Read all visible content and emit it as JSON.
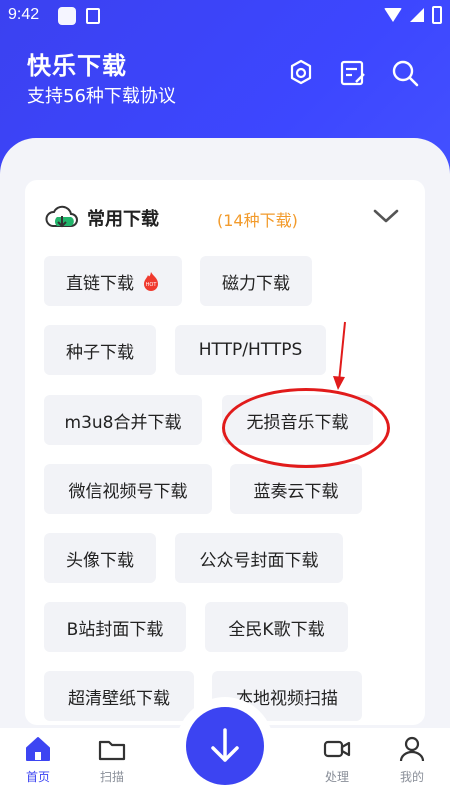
{
  "status_bar": {
    "time": "9:42"
  },
  "header": {
    "title": "快乐下载",
    "subtitle": "支持56种下载协议"
  },
  "section": {
    "title": "常用下载",
    "count": "(14种下载)",
    "chips": [
      "直链下载",
      "磁力下载",
      "种子下载",
      "HTTP/HTTPS",
      "m3u8合并下载",
      "无损音乐下载",
      "微信视频号下载",
      "蓝奏云下载",
      "头像下载",
      "公众号封面下载",
      "B站封面下载",
      "全民K歌下载",
      "超清壁纸下载",
      "本地视频扫描"
    ],
    "hot_badge": "HOT"
  },
  "tabbar": {
    "home": "首页",
    "scan": "扫描",
    "process": "处理",
    "mine": "我的"
  },
  "colors": {
    "accent": "#3c44f2",
    "count": "#f29b2c",
    "annotation": "#e11b1b"
  }
}
